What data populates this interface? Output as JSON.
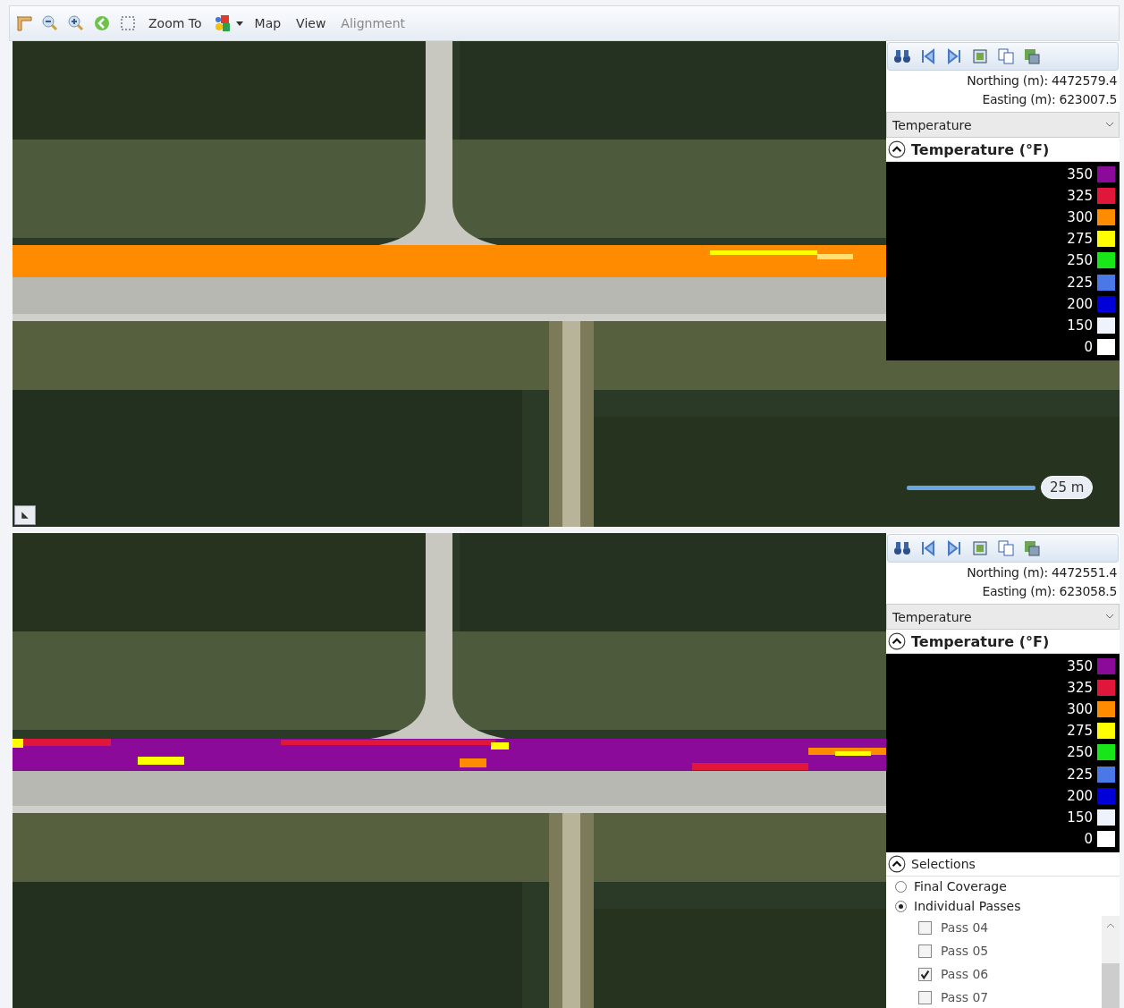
{
  "toolbar": {
    "items": [
      {
        "label": "Zoom To",
        "disabled": false
      },
      {
        "label": "Map",
        "disabled": false
      },
      {
        "label": "View",
        "disabled": false
      },
      {
        "label": "Alignment",
        "disabled": true
      }
    ]
  },
  "panels": [
    {
      "northing": "Northing (m): 4472579.4",
      "easting": "Easting (m): 623007.5",
      "dropdown": "Temperature",
      "legend_title": "Temperature (°F)",
      "swath": {
        "kind": "uniform"
      },
      "scale": "25 m",
      "legend": [
        {
          "label": "350",
          "color": "#8b0a9a"
        },
        {
          "label": "325",
          "color": "#e0163a"
        },
        {
          "label": "300",
          "color": "#ff8c00"
        },
        {
          "label": "275",
          "color": "#ffff00"
        },
        {
          "label": "250",
          "color": "#19e619"
        },
        {
          "label": "225",
          "color": "#4a78e6"
        },
        {
          "label": "200",
          "color": "#0000d8"
        },
        {
          "label": "150",
          "color": "#eef2fa"
        },
        {
          "label": "0",
          "color": "#ffffff"
        }
      ]
    },
    {
      "northing": "Northing (m): 4472551.4",
      "easting": "Easting (m): 623058.5",
      "dropdown": "Temperature",
      "legend_title": "Temperature (°F)",
      "swath": {
        "kind": "mixed"
      },
      "legend": [
        {
          "label": "350",
          "color": "#8b0a9a"
        },
        {
          "label": "325",
          "color": "#e0163a"
        },
        {
          "label": "300",
          "color": "#ff8c00"
        },
        {
          "label": "275",
          "color": "#ffff00"
        },
        {
          "label": "250",
          "color": "#19e619"
        },
        {
          "label": "225",
          "color": "#4a78e6"
        },
        {
          "label": "200",
          "color": "#0000d8"
        },
        {
          "label": "150",
          "color": "#eef2fa"
        },
        {
          "label": "0",
          "color": "#ffffff"
        }
      ],
      "selections": {
        "title": "Selections",
        "options": [
          {
            "label": "Final Coverage",
            "selected": false
          },
          {
            "label": "Individual Passes",
            "selected": true
          }
        ],
        "passes": [
          {
            "label": "Pass 04",
            "checked": false
          },
          {
            "label": "Pass 05",
            "checked": false
          },
          {
            "label": "Pass 06",
            "checked": true
          },
          {
            "label": "Pass 07",
            "checked": false
          }
        ]
      }
    }
  ]
}
